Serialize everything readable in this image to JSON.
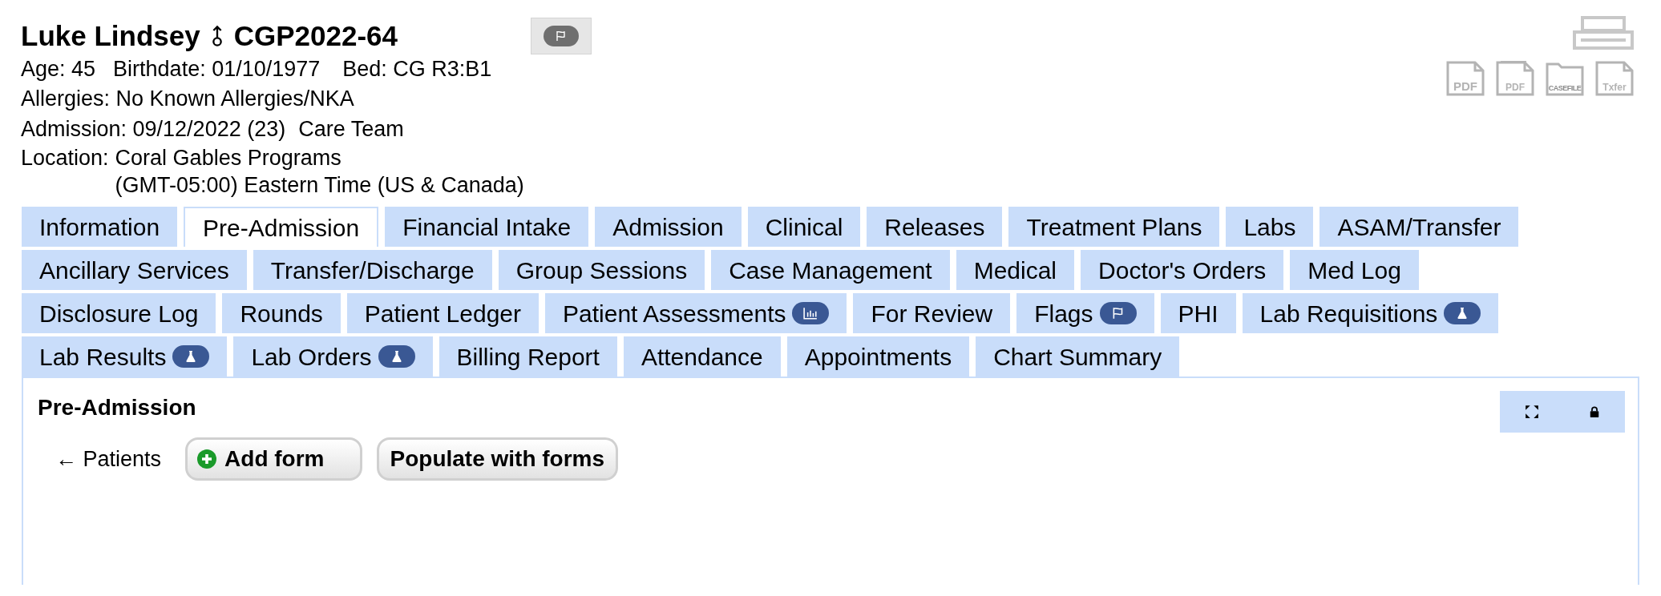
{
  "patient": {
    "name": "Luke Lindsey",
    "id": "CGP2022-64",
    "age": "Age: 45",
    "birthdate": "Birthdate: 01/10/1977",
    "bed": "Bed: CG R3:B1",
    "allergies": "Allergies: No Known Allergies/NKA",
    "admission": "Admission: 09/12/2022 (23)",
    "care_team": "Care Team",
    "location_label": "Location:",
    "location": "Coral Gables Programs",
    "timezone": "(GMT-05:00) Eastern Time (US & Canada)"
  },
  "export_icons": [
    {
      "kind": "pdf",
      "label": "PDF"
    },
    {
      "kind": "pdf_multi",
      "label": "PDF"
    },
    {
      "kind": "folder",
      "label": "CASEFILE"
    },
    {
      "kind": "doc",
      "label": "Txfer"
    }
  ],
  "tab_rows": [
    [
      {
        "label": "Information",
        "selected": false,
        "kind": "plain"
      },
      {
        "label": "Pre-Admission",
        "selected": true,
        "kind": "plain"
      },
      {
        "label": "Financial Intake",
        "selected": false,
        "kind": "plain"
      },
      {
        "label": "Admission",
        "selected": false,
        "kind": "plain"
      },
      {
        "label": "Clinical",
        "selected": false,
        "kind": "plain"
      },
      {
        "label": "Releases",
        "selected": false,
        "kind": "plain"
      },
      {
        "label": "Treatment Plans",
        "selected": false,
        "kind": "plain"
      },
      {
        "label": "Labs",
        "selected": false,
        "kind": "plain"
      },
      {
        "label": "ASAM/Transfer",
        "selected": false,
        "kind": "plain"
      }
    ],
    [
      {
        "label": "Ancillary Services",
        "selected": false,
        "kind": "plain"
      },
      {
        "label": "Transfer/Discharge",
        "selected": false,
        "kind": "plain"
      },
      {
        "label": "Group Sessions",
        "selected": false,
        "kind": "plain"
      },
      {
        "label": "Case Management",
        "selected": false,
        "kind": "plain"
      },
      {
        "label": "Medical",
        "selected": false,
        "kind": "plain"
      },
      {
        "label": "Doctor's Orders",
        "selected": false,
        "kind": "plain"
      },
      {
        "label": "Med Log",
        "selected": false,
        "kind": "plain"
      }
    ],
    [
      {
        "label": "Disclosure Log",
        "selected": false,
        "kind": "plain"
      },
      {
        "label": "Rounds",
        "selected": false,
        "kind": "plain"
      },
      {
        "label": "Patient Ledger",
        "selected": false,
        "kind": "plain"
      },
      {
        "label": "Patient Assessments",
        "selected": false,
        "kind": "chart"
      },
      {
        "label": "For Review",
        "selected": false,
        "kind": "plain"
      },
      {
        "label": "Flags",
        "selected": false,
        "kind": "flag"
      },
      {
        "label": "PHI",
        "selected": false,
        "kind": "plain"
      },
      {
        "label": "Lab Requisitions",
        "selected": false,
        "kind": "flask"
      }
    ],
    [
      {
        "label": "Lab Results",
        "selected": false,
        "kind": "flask"
      },
      {
        "label": "Lab Orders",
        "selected": false,
        "kind": "flask"
      },
      {
        "label": "Billing Report",
        "selected": false,
        "kind": "plain"
      },
      {
        "label": "Attendance",
        "selected": false,
        "kind": "plain"
      },
      {
        "label": "Appointments",
        "selected": false,
        "kind": "plain"
      },
      {
        "label": "Chart Summary",
        "selected": false,
        "kind": "plain"
      }
    ]
  ],
  "panel": {
    "title": "Pre-Admission",
    "back_link": "← Patients",
    "buttons": [
      {
        "label": "Add form",
        "kind": "add"
      },
      {
        "label": "Populate with forms",
        "kind": "plain"
      }
    ]
  }
}
